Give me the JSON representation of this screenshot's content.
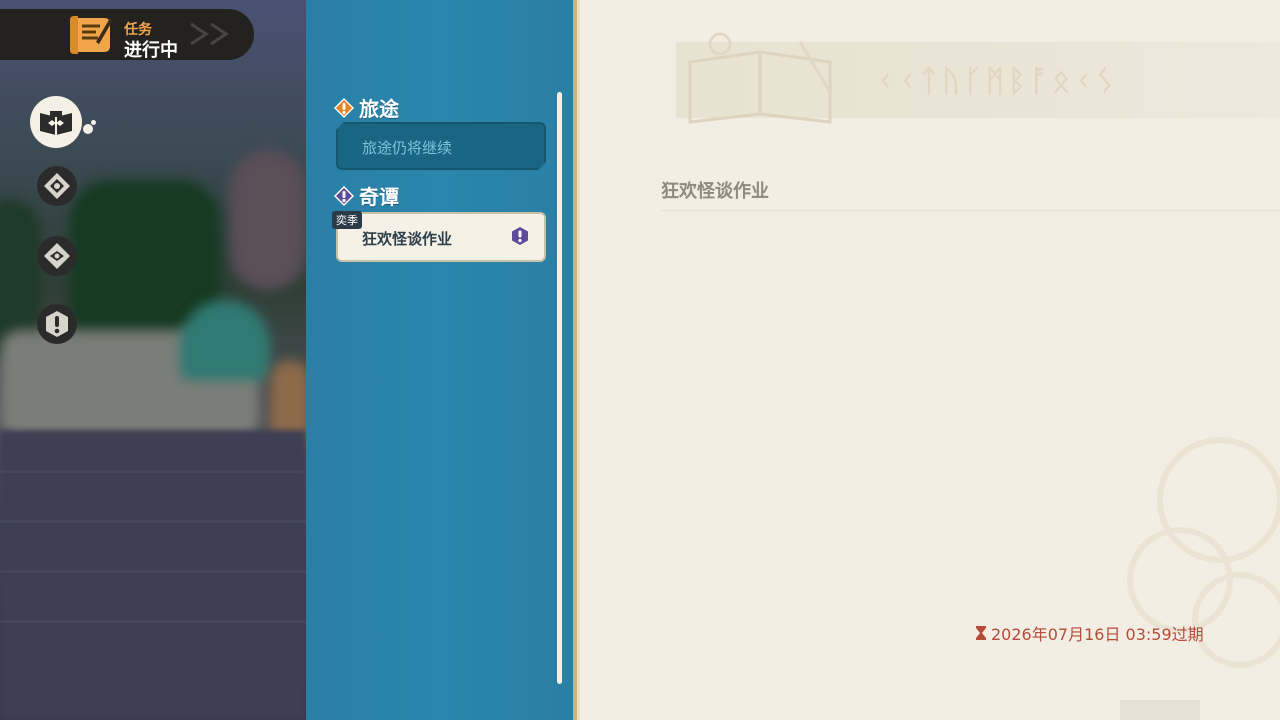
{
  "quest_header": {
    "small": "任务",
    "big": "进行中"
  },
  "categories": [
    {
      "name": "journal-book",
      "active": true
    },
    {
      "name": "compass-diamond"
    },
    {
      "name": "gear-diamond"
    },
    {
      "name": "exclamation"
    }
  ],
  "sections": [
    {
      "title": "旅途",
      "icon_color": "#e8801f",
      "items": [
        {
          "label": "旅途仍将继续"
        }
      ]
    },
    {
      "title": "奇谭",
      "icon_color": "#5d4a9a",
      "items": [
        {
          "label": "狂欢怪谈作业",
          "tag": "奕季"
        }
      ]
    }
  ],
  "detail": {
    "banner_text": "ᚲᚲᛏᚢᚴᛗᛒᚩᛟᚲᛊ",
    "title": "狂欢怪谈作业",
    "expire_text": "2026年07月16日 03:59过期"
  },
  "colors": {
    "list_bg": "#2a86ad",
    "detail_bg": "#f2eee3",
    "expire": "#b54b3a",
    "accent_orange": "#f1a54a"
  }
}
